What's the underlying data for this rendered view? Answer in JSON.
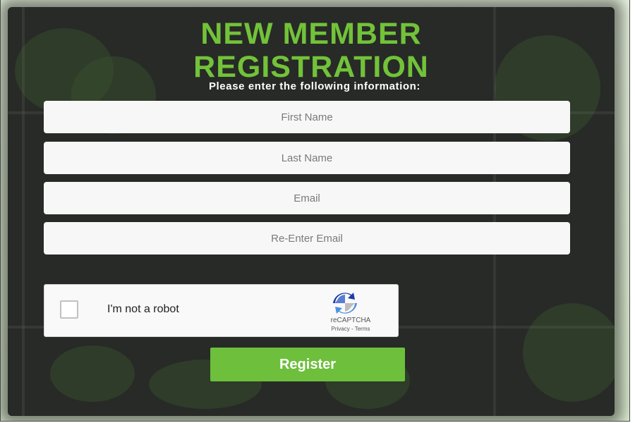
{
  "header": {
    "title_line1": "NEW MEMBER",
    "title_line2": "REGISTRATION",
    "subtitle": "Please enter the following information:"
  },
  "form": {
    "first_name": {
      "placeholder": "First Name",
      "value": ""
    },
    "last_name": {
      "placeholder": "Last Name",
      "value": ""
    },
    "email": {
      "placeholder": "Email",
      "value": ""
    },
    "reenter_email": {
      "placeholder": "Re-Enter Email",
      "value": ""
    }
  },
  "recaptcha": {
    "label": "I'm not a robot",
    "brand": "reCAPTCHA",
    "privacy": "Privacy",
    "separator": " - ",
    "terms": "Terms",
    "icon": "recaptcha-logo-icon"
  },
  "actions": {
    "register_label": "Register"
  },
  "colors": {
    "accent_green": "#72c23a",
    "button_green": "#6dbf3c",
    "panel_dark": "#272a26"
  }
}
